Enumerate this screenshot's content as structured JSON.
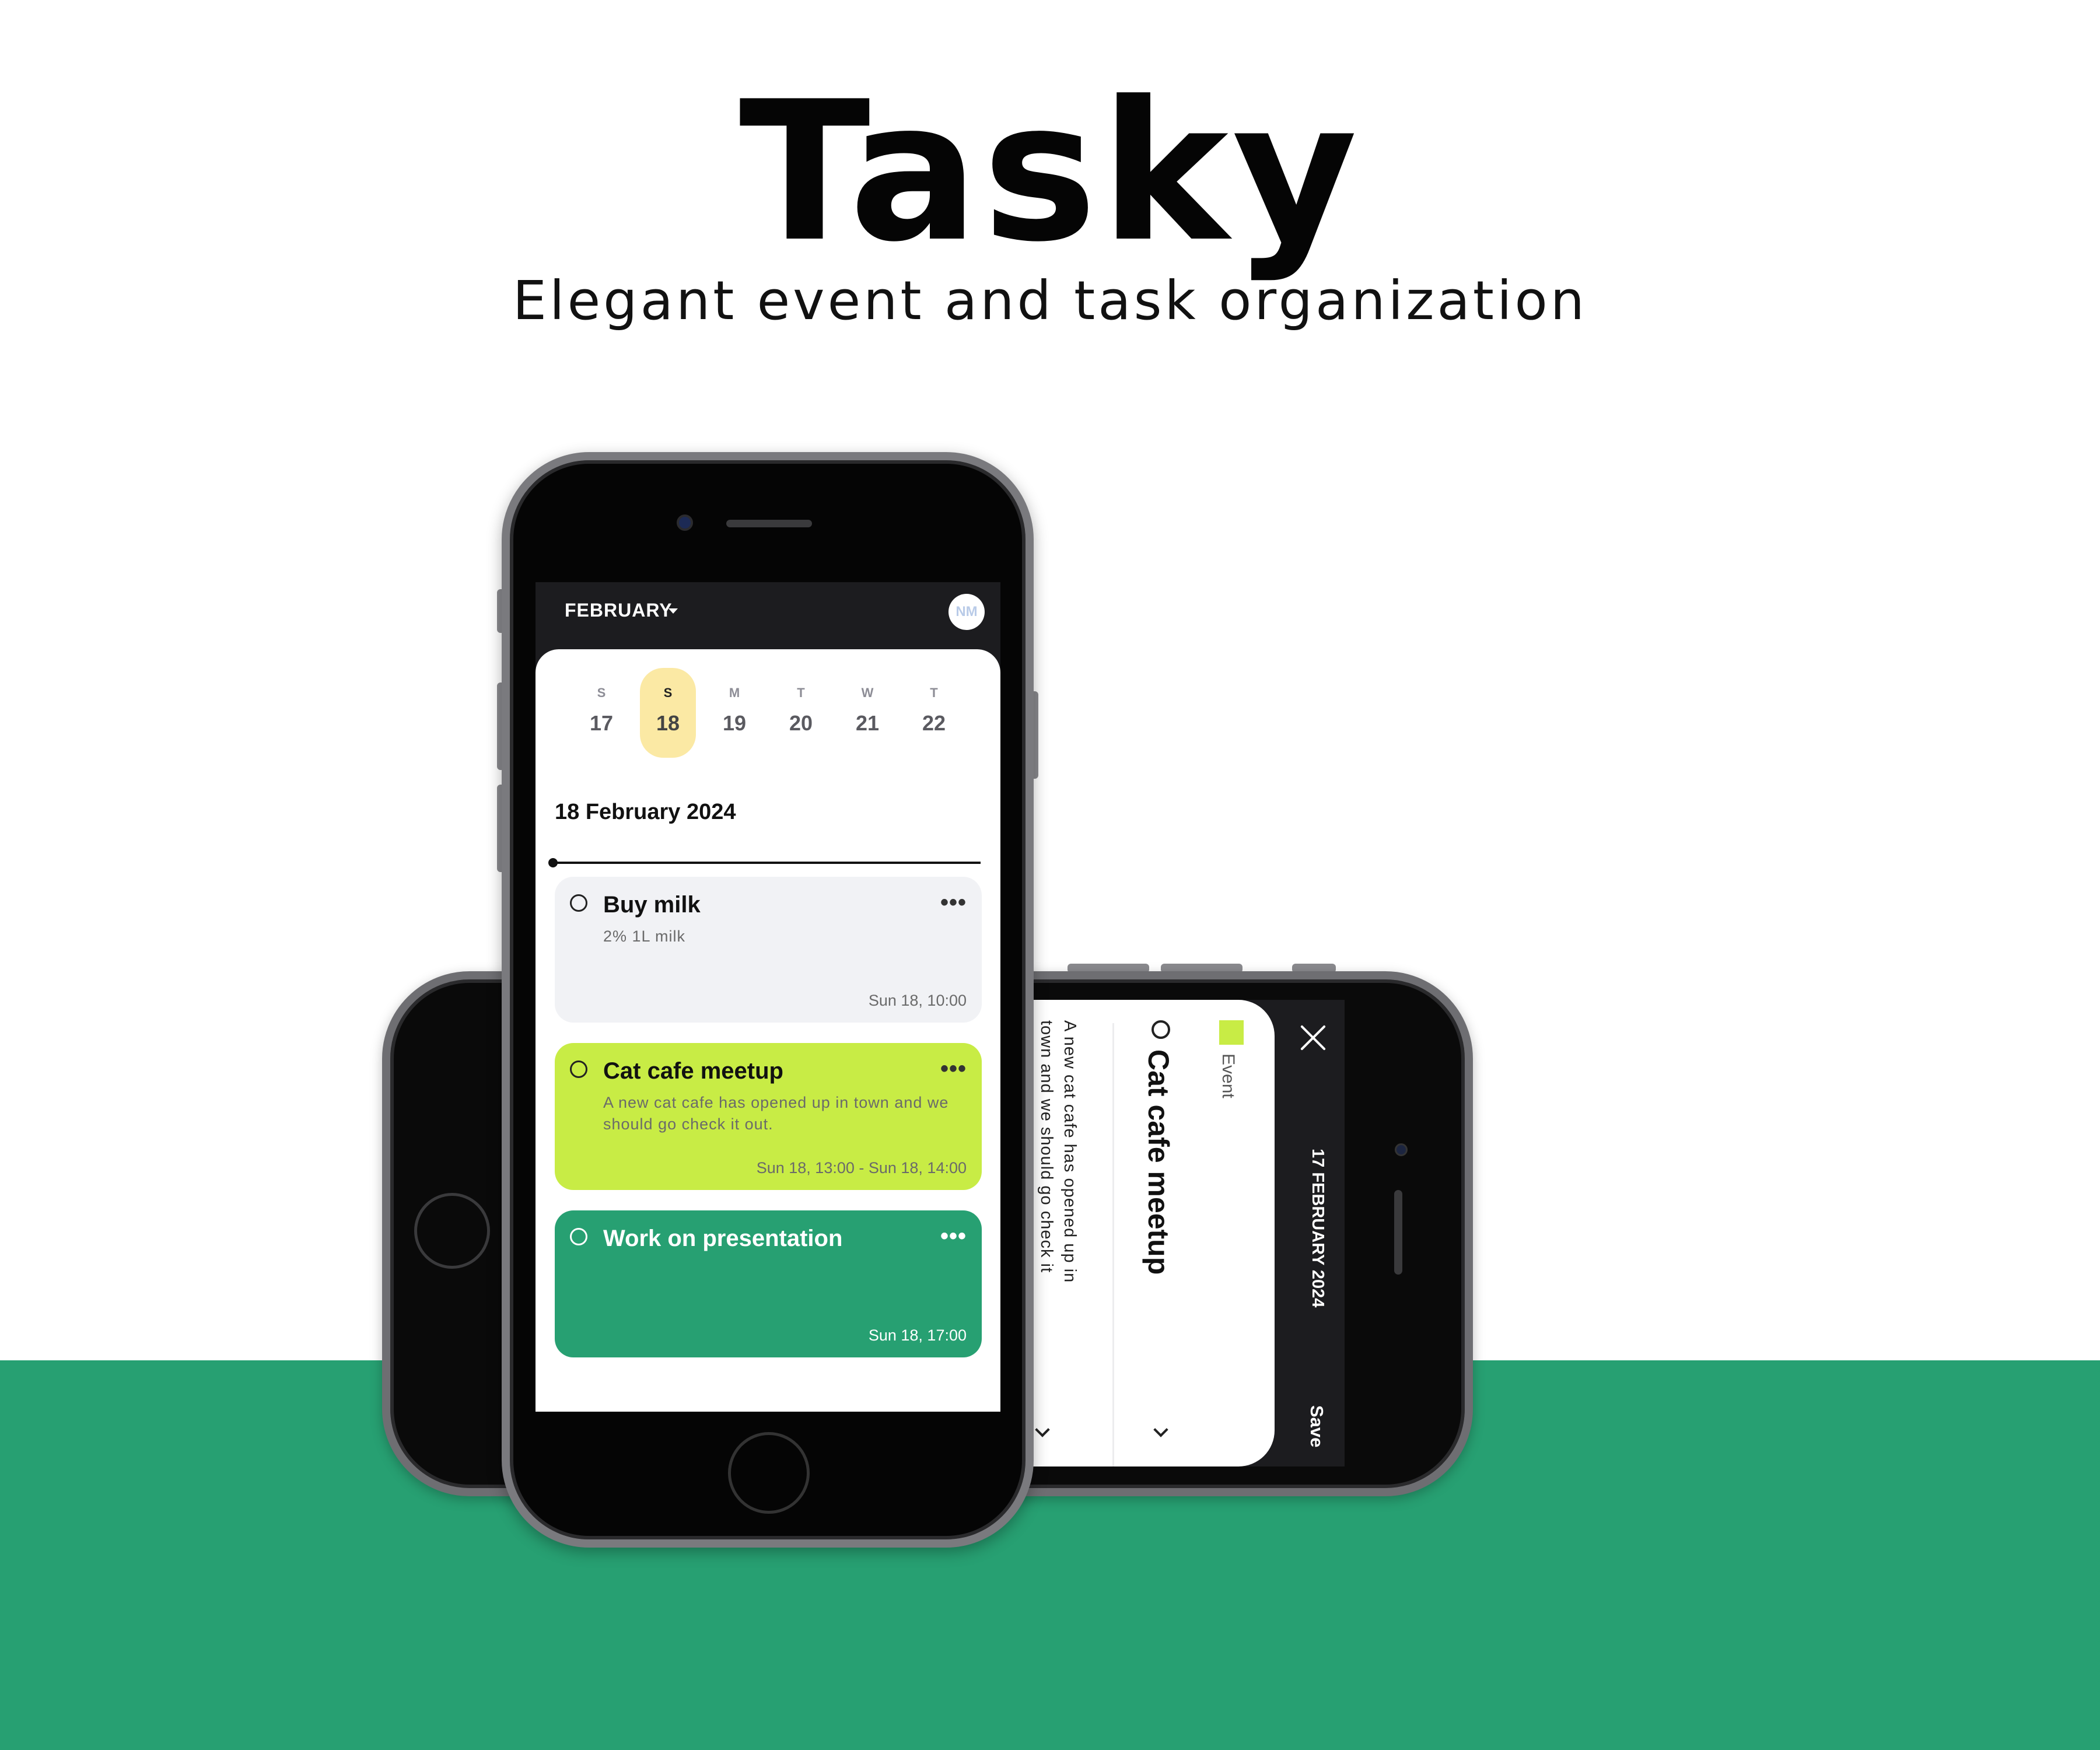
{
  "hero": {
    "title": "Tasky",
    "subtitle": "Elegant event and task organization"
  },
  "colors": {
    "brand_green": "#27a072",
    "event_lime": "#c8ec45",
    "selected_day": "#fbe9a4",
    "task_gray": "#f1f2f5"
  },
  "calendar": {
    "month_label": "FEBRUARY",
    "avatar_initials": "NM",
    "days": [
      {
        "dow": "S",
        "num": "17"
      },
      {
        "dow": "S",
        "num": "18"
      },
      {
        "dow": "M",
        "num": "19"
      },
      {
        "dow": "T",
        "num": "20"
      },
      {
        "dow": "W",
        "num": "21"
      },
      {
        "dow": "T",
        "num": "22"
      }
    ],
    "selected_day": "18",
    "date_heading": "18 February 2024"
  },
  "tasks": [
    {
      "title": "Buy milk",
      "description": "2% 1L milk",
      "time": "Sun 18, 10:00",
      "more": "•••"
    },
    {
      "title": "Cat cafe meetup",
      "description": "A new cat cafe has opened up in town and we should go check it out.",
      "time": "Sun 18, 13:00 - Sun 18, 14:00",
      "more": "•••"
    },
    {
      "title": "Work on presentation",
      "description": "",
      "time": "Sun 18, 17:00",
      "more": "•••"
    }
  ],
  "event_editor": {
    "date_label": "17 FEBRUARY 2024",
    "save_label": "Save",
    "type_label": "Event",
    "title": "Cat cafe meetup",
    "description_line1": "A new cat cafe has opened up in",
    "description_line2": "town and we should go check it"
  },
  "icons": [
    "dropdown-caret-icon",
    "more-horizontal-icon",
    "checkbox-circle-icon",
    "close-icon",
    "chevron-down-icon"
  ]
}
